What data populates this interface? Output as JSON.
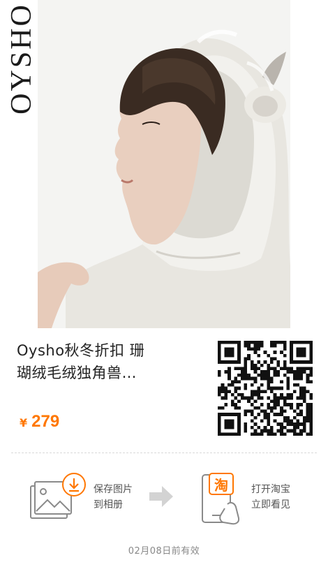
{
  "brand": {
    "logo_text": "OYSHO"
  },
  "product": {
    "title_line1": "Oysho秋冬折扣 珊",
    "title_line2": "瑚绒毛绒独角兽…",
    "currency": "¥",
    "price": "279"
  },
  "steps": {
    "save_line1": "保存图片",
    "save_line2": "到相册",
    "taobao_badge": "淘",
    "open_line1": "打开淘宝",
    "open_line2": "立即看见"
  },
  "footer": {
    "validity": "02月08日前有效"
  },
  "colors": {
    "accent": "#ff7700",
    "text": "#222222",
    "muted": "#888888",
    "icon_stroke": "#888888"
  },
  "icons": {
    "save": "download-image-icon",
    "arrow": "right-arrow-icon",
    "phone": "taobao-phone-icon"
  }
}
